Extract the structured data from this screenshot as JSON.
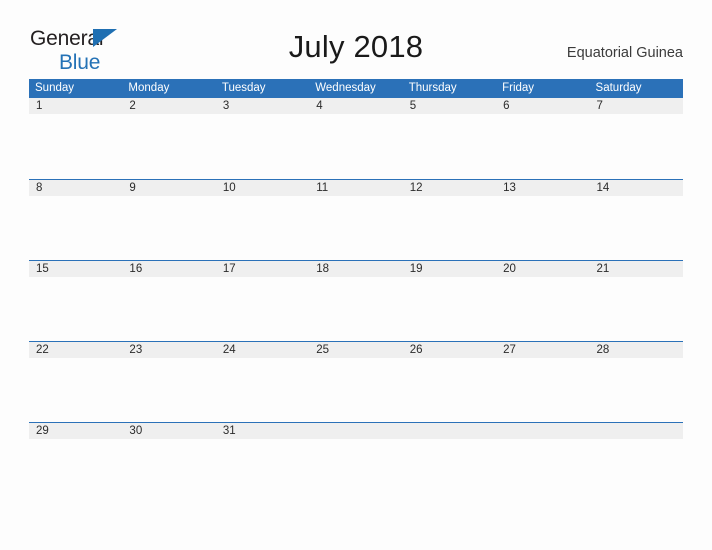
{
  "brand": {
    "line1": "General",
    "line2": "Blue",
    "triangle_color": "#1f6fb2",
    "text_color": "#231f20",
    "blue_text_color": "#2472b6"
  },
  "header": {
    "title": "July 2018",
    "country": "Equatorial Guinea"
  },
  "theme": {
    "header_blue": "#2b71b8",
    "row_gray": "#efefef",
    "page_background": "#fdfdfd",
    "date_text": "#2b2b2b"
  },
  "calendar": {
    "weekday_headers": [
      "Sunday",
      "Monday",
      "Tuesday",
      "Wednesday",
      "Thursday",
      "Friday",
      "Saturday"
    ],
    "weeks": [
      [
        "1",
        "2",
        "3",
        "4",
        "5",
        "6",
        "7"
      ],
      [
        "8",
        "9",
        "10",
        "11",
        "12",
        "13",
        "14"
      ],
      [
        "15",
        "16",
        "17",
        "18",
        "19",
        "20",
        "21"
      ],
      [
        "22",
        "23",
        "24",
        "25",
        "26",
        "27",
        "28"
      ],
      [
        "29",
        "30",
        "31",
        "",
        "",
        "",
        ""
      ]
    ]
  }
}
